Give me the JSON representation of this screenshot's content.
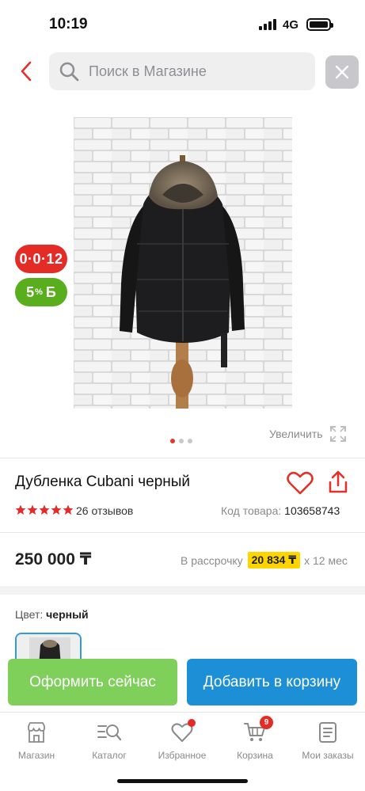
{
  "status_bar": {
    "time": "10:19",
    "network": "4G"
  },
  "search": {
    "placeholder": "Поиск в Магазине"
  },
  "badges": {
    "timer": "0·0·12",
    "bonus_value": "5",
    "bonus_suffix": "%",
    "bonus_currency": "Б"
  },
  "gallery": {
    "image_count": 3,
    "active_index": 0,
    "zoom_label": "Увеличить"
  },
  "product": {
    "title": "Дубленка Cubani черный",
    "rating_stars": 5,
    "reviews": "26 отзывов",
    "code_label": "Код товара:",
    "code": "103658743",
    "price": "250 000 ₸",
    "installment_label": "В рассрочку",
    "installment_amount": "20 834 ₸",
    "installment_term": "х 12 мес",
    "color_label": "Цвет:",
    "color_value": "черный"
  },
  "actions": {
    "order_now": "Оформить сейчас",
    "add_to_cart": "Добавить в корзину"
  },
  "tabbar": {
    "items": [
      {
        "label": "Магазин",
        "icon": "shop-icon"
      },
      {
        "label": "Каталог",
        "icon": "catalog-search-icon"
      },
      {
        "label": "Избранное",
        "icon": "heart-icon"
      },
      {
        "label": "Корзина",
        "icon": "cart-icon",
        "badge": "9"
      },
      {
        "label": "Мои заказы",
        "icon": "orders-icon"
      }
    ]
  },
  "colors": {
    "accent_red": "#e52b25",
    "green": "#7ed05a",
    "blue": "#1c8fd6",
    "yellow": "#ffd500"
  }
}
